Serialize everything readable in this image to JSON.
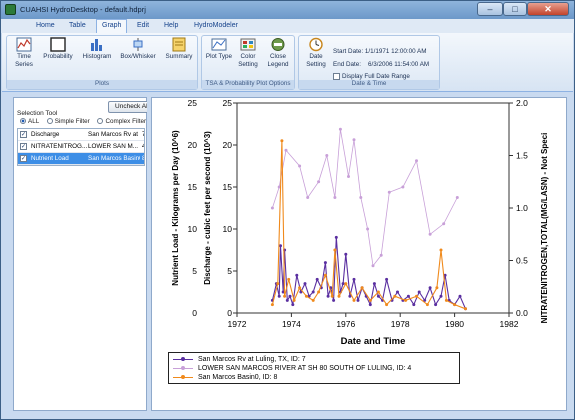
{
  "window": {
    "title": "CUAHSI HydroDesktop - default.hdprj"
  },
  "menu": {
    "items": [
      "Home",
      "Table",
      "Graph",
      "Edit",
      "Help",
      "HydroModeler"
    ],
    "active_index": 2
  },
  "ribbon": {
    "groups": {
      "plots": {
        "label": "Plots",
        "buttons": {
          "time_series": "Time Series",
          "probability": "Probability",
          "histogram": "Histogram",
          "box_whisker": "Box/Whisker",
          "summary": "Summary"
        }
      },
      "tsa": {
        "label": "TSA & Probability Plot Options",
        "buttons": {
          "plot_type": "Plot Type",
          "color_setting": "Color Setting",
          "close_legend": "Close Legend"
        }
      },
      "date_time": {
        "label": "Date & Time",
        "buttons": {
          "date_setting": "Date Setting"
        },
        "start_date": "Start Date: 1/1/1971 12:00:00 AM",
        "end_date": "End Date:    6/3/2006 11:54:00 AM",
        "display_full_range": "Display Full Date Range"
      }
    }
  },
  "selection_panel": {
    "uncheck_all": "Uncheck All",
    "selection_tool_label": "Selection Tool",
    "options": [
      "ALL",
      "Simple Filter",
      "Complex Filter"
    ],
    "selected_option": 0,
    "rows": [
      {
        "variable": "Discharge",
        "site": "San Marcos Rv at Lu",
        "id": "7",
        "checked": "✓"
      },
      {
        "variable": "NITRATENITROG...",
        "site": "LOWER SAN M...",
        "id": "4",
        "checked": "✓"
      },
      {
        "variable": "Nutrient Load",
        "site": "San Marcos Basin0",
        "id": "8",
        "checked": "✓"
      }
    ]
  },
  "chart": {
    "xlabel": "Date and Time",
    "ylabel_left_outer": "Nutrient Load - Kilograms per Day (10^6)",
    "ylabel_left_inner": "Discharge - cubic feet per second (10^3)",
    "ylabel_right": "NITRATENITROGEN,TOTAL(MG/LASN) - Not Speci",
    "x_ticks": [
      "1972",
      "1974",
      "1976",
      "1978",
      "1980",
      "1982"
    ],
    "y_outer_ticks": [
      "25",
      "20",
      "15",
      "10",
      "5",
      "0"
    ],
    "y_inner_ticks": [
      "25",
      "20",
      "15",
      "10",
      "5",
      "0"
    ],
    "y_right_ticks": [
      "2.0",
      "1.5",
      "1.0",
      "0.5",
      "0.0"
    ],
    "legend": [
      {
        "label": "San Marcos Rv at Luling, TX, ID: 7",
        "color": "#5a2fa0"
      },
      {
        "label": "LOWER SAN MARCOS RIVER AT SH 80 SOUTH OF LULING, ID: 4",
        "color": "#c8a0d8"
      },
      {
        "label": "San Marcos Basin0, ID: 8",
        "color": "#f08a1c"
      }
    ]
  },
  "chart_data": {
    "type": "line",
    "xlabel": "Date and Time",
    "xlim": [
      1972,
      1982
    ],
    "ylim_left": [
      0,
      25
    ],
    "ylim_right": [
      0,
      2.0
    ],
    "series": [
      {
        "name": "San Marcos Rv at Luling, TX, ID: 7",
        "axis": "left",
        "x": [
          1973.3,
          1973.45,
          1973.55,
          1973.6,
          1973.7,
          1973.75,
          1973.85,
          1973.95,
          1974.05,
          1974.2,
          1974.35,
          1974.5,
          1974.65,
          1974.8,
          1974.95,
          1975.1,
          1975.25,
          1975.35,
          1975.45,
          1975.55,
          1975.65,
          1975.8,
          1975.9,
          1976.0,
          1976.15,
          1976.3,
          1976.45,
          1976.6,
          1976.75,
          1976.9,
          1977.05,
          1977.2,
          1977.35,
          1977.5,
          1977.7,
          1977.9,
          1978.1,
          1978.3,
          1978.5,
          1978.7,
          1978.9,
          1979.1,
          1979.3,
          1979.5,
          1979.65,
          1979.8,
          1980.0,
          1980.2,
          1980.4
        ],
        "y": [
          1.5,
          3.5,
          2.0,
          8.0,
          2.5,
          7.5,
          1.5,
          2.0,
          1.0,
          4.5,
          2.5,
          3.5,
          2.0,
          2.5,
          4.0,
          3.0,
          6.0,
          2.0,
          3.0,
          1.5,
          9.0,
          2.5,
          3.5,
          7.0,
          2.0,
          4.0,
          1.5,
          3.0,
          2.0,
          1.0,
          3.5,
          2.0,
          1.5,
          4.0,
          1.5,
          2.5,
          1.5,
          2.0,
          1.0,
          2.5,
          1.5,
          3.0,
          1.0,
          2.0,
          4.5,
          1.5,
          1.0,
          2.0,
          0.5
        ]
      },
      {
        "name": "LOWER SAN MARCOS RIVER AT SH 80 SOUTH OF LULING, ID: 4",
        "axis": "right",
        "x": [
          1973.3,
          1973.55,
          1973.8,
          1974.3,
          1974.6,
          1975.0,
          1975.3,
          1975.6,
          1975.8,
          1976.1,
          1976.3,
          1976.55,
          1976.8,
          1977.0,
          1977.3,
          1977.6,
          1978.1,
          1978.6,
          1979.1,
          1979.6,
          1980.1
        ],
        "y": [
          1.0,
          1.2,
          1.55,
          1.4,
          1.1,
          1.25,
          1.5,
          1.1,
          1.75,
          1.3,
          1.65,
          1.1,
          0.8,
          0.45,
          0.55,
          1.15,
          1.2,
          1.45,
          0.75,
          0.85,
          1.1
        ]
      },
      {
        "name": "San Marcos Basin0, ID: 8",
        "axis": "left",
        "x": [
          1973.3,
          1973.5,
          1973.65,
          1973.75,
          1973.9,
          1974.1,
          1974.3,
          1974.55,
          1974.8,
          1975.0,
          1975.25,
          1975.5,
          1975.6,
          1975.75,
          1976.0,
          1976.3,
          1976.6,
          1976.9,
          1977.2,
          1977.5,
          1977.8,
          1978.2,
          1978.6,
          1979.0,
          1979.35,
          1979.5,
          1979.7,
          1980.0,
          1980.4
        ],
        "y": [
          1.0,
          3.5,
          20.5,
          2.0,
          4.0,
          1.5,
          3.0,
          2.0,
          1.5,
          2.5,
          4.5,
          2.0,
          7.5,
          2.0,
          3.5,
          1.5,
          3.0,
          1.5,
          2.5,
          1.0,
          2.0,
          1.5,
          2.0,
          1.0,
          3.0,
          7.5,
          1.5,
          1.0,
          0.5
        ]
      }
    ]
  }
}
